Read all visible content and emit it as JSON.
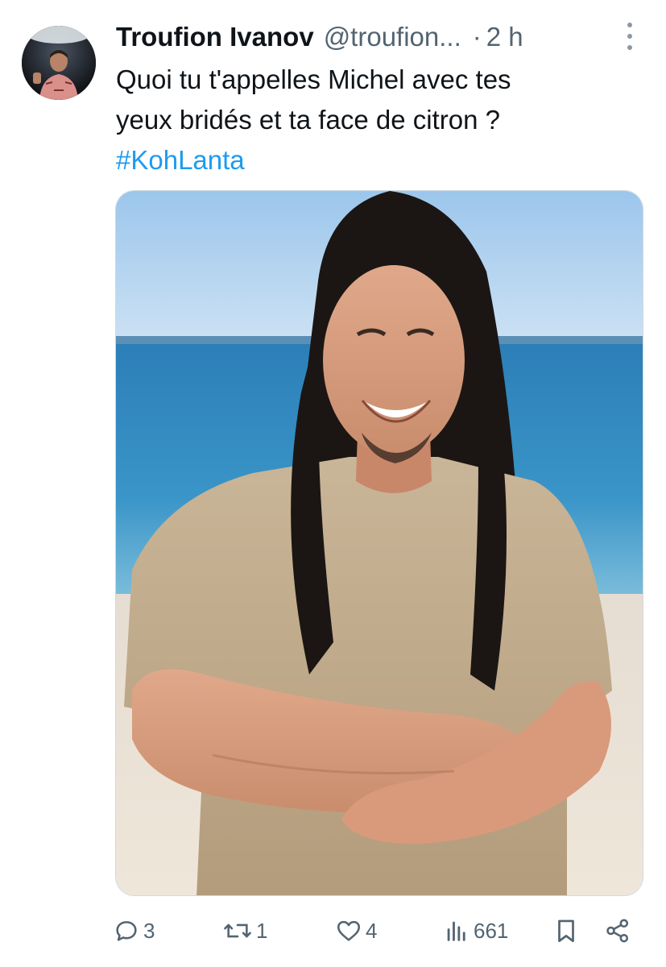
{
  "tweet": {
    "author": {
      "display_name": "Troufion Ivanov",
      "handle": "@troufion...",
      "separator": "·",
      "time": "2 h"
    },
    "text_line1": "Quoi tu t'appelles Michel avec tes",
    "text_line2": "yeux bridés et ta face de citron ?",
    "hashtag": "#KohLanta"
  },
  "actions": {
    "replies": "3",
    "reposts": "1",
    "likes": "4",
    "views": "661"
  },
  "icons": {
    "reply": "reply-icon",
    "repost": "repost-icon",
    "like": "heart-icon",
    "views": "views-icon",
    "bookmark": "bookmark-icon",
    "share": "share-icon",
    "more": "more-vertical-icon"
  },
  "colors": {
    "link": "#1d9bf0",
    "secondary_text": "#536471",
    "primary_text": "#0f1419"
  }
}
